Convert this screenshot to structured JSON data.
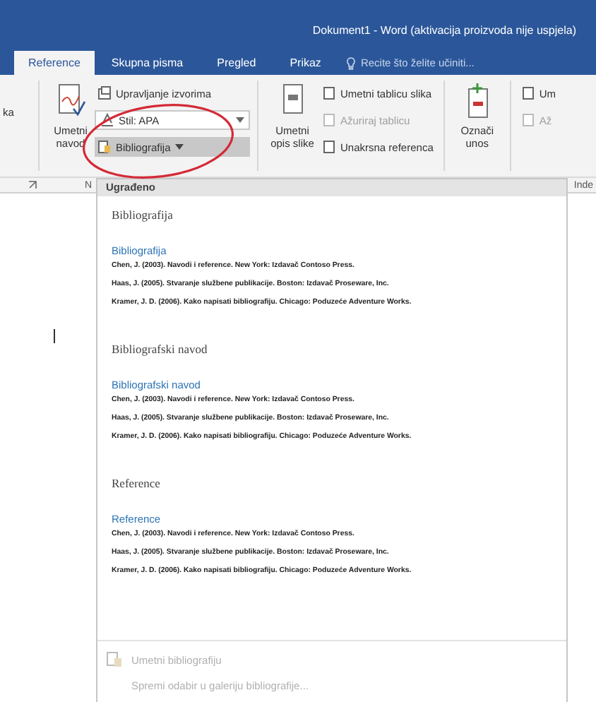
{
  "window": {
    "title": "Dokument1 - Word (aktivacija proizvoda nije uspjela)"
  },
  "tabs": [
    {
      "label": "Reference",
      "selected": true
    },
    {
      "label": "Skupna pisma",
      "selected": false
    },
    {
      "label": "Pregled",
      "selected": false
    },
    {
      "label": "Prikaz",
      "selected": false
    }
  ],
  "tell_me": {
    "placeholder": "Recite što želite učiniti..."
  },
  "ribbon": {
    "left_cut": "ka",
    "insert_citation": [
      "Umetni",
      "navod"
    ],
    "manage_sources": "Upravljanje izvorima",
    "style": {
      "label": "Stil:",
      "value": "APA"
    },
    "bibliography_button": "Bibliografija",
    "insert_caption": [
      "Umetni",
      "opis slike"
    ],
    "small_buttons": [
      {
        "label": "Umetni tablicu slika",
        "disabled": false
      },
      {
        "label": "Ažuriraj tablicu",
        "disabled": true
      },
      {
        "label": "Unakrsna referenca",
        "disabled": false
      }
    ],
    "mark_entry": [
      "Označi",
      "unos"
    ],
    "right_cut": [
      {
        "label": "Um",
        "disabled": false
      },
      {
        "label": "Až",
        "disabled": true
      }
    ],
    "group_labels": [
      "N",
      "Inde"
    ]
  },
  "menu": {
    "header": "Ugrađeno",
    "sections": [
      {
        "title": "Bibliografija",
        "preview_heading": "Bibliografija",
        "entries": [
          "Chen, J. (2003). Navodi i reference. New York: Izdavač Contoso Press.",
          "Haas, J. (2005). Stvaranje službene publikacije. Boston: Izdavač Proseware, Inc.",
          "Kramer, J. D. (2006). Kako napisati bibliografiju. Chicago: Poduzeće Adventure Works."
        ]
      },
      {
        "title": "Bibliografski navod",
        "preview_heading": "Bibliografski navod",
        "entries": [
          "Chen, J. (2003). Navodi i reference. New York: Izdavač Contoso Press.",
          "Haas, J. (2005). Stvaranje službene publikacije. Boston: Izdavač Proseware, Inc.",
          "Kramer, J. D. (2006). Kako napisati bibliografiju. Chicago: Poduzeće Adventure Works."
        ]
      },
      {
        "title": "Reference",
        "preview_heading": "Reference",
        "entries": [
          "Chen, J. (2003). Navodi i reference. New York: Izdavač Contoso Press.",
          "Haas, J. (2005). Stvaranje službene publikacije. Boston: Izdavač Proseware, Inc.",
          "Kramer, J. D. (2006). Kako napisati bibliografiju. Chicago: Poduzeće Adventure Works."
        ]
      }
    ],
    "actions": [
      {
        "label": "Umetni bibliografiju",
        "disabled": true
      },
      {
        "label": "Spremi odabir u galeriju bibliografije...",
        "disabled": true
      }
    ]
  }
}
